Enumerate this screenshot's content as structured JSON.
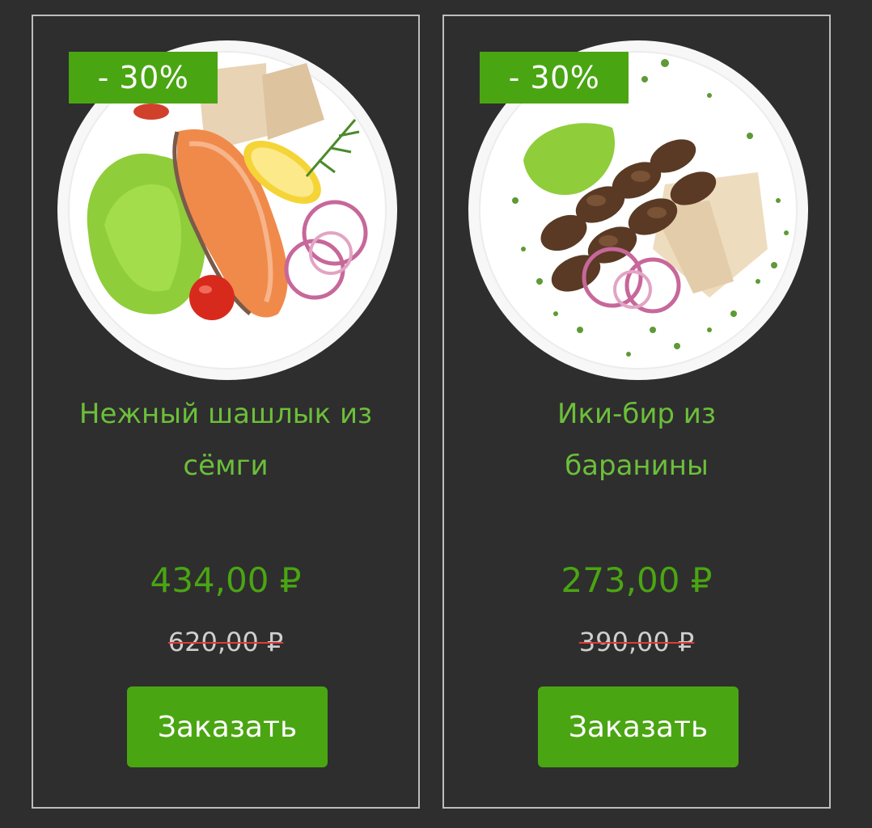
{
  "products": [
    {
      "discount_badge": "- 30%",
      "title_line1": "Нежный шашлык из",
      "title_line2": "сёмги",
      "price": "434,00 ₽",
      "old_price": "620,00 ₽",
      "order_label": "Заказать",
      "image_name": "salmon-skewer-plate"
    },
    {
      "discount_badge": "- 30%",
      "title_line1": "Ики-бир из",
      "title_line2": "баранины",
      "price": "273,00 ₽",
      "old_price": "390,00 ₽",
      "order_label": "Заказать",
      "image_name": "lamb-kebab-plate"
    }
  ],
  "colors": {
    "background": "#2e2e2e",
    "accent": "#4aa512",
    "title": "#6cbf3a",
    "card_border": "#bdbdbd",
    "strike": "#e03a3a"
  }
}
